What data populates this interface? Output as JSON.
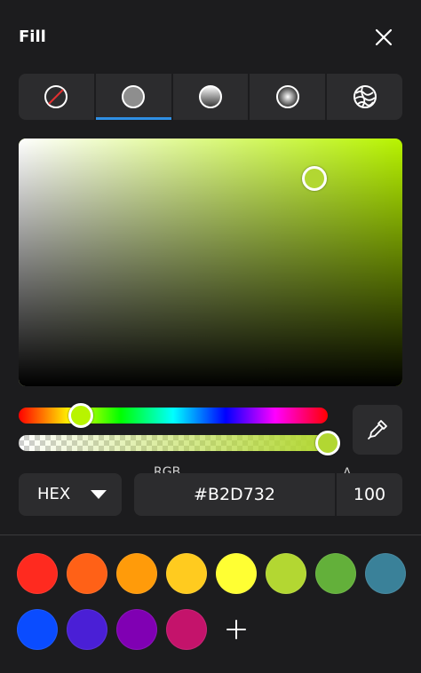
{
  "header": {
    "title": "Fill",
    "close_icon": "close-icon"
  },
  "fill_types": [
    {
      "id": "none",
      "icon": "no-fill-icon",
      "active": false
    },
    {
      "id": "solid",
      "icon": "solid-fill-icon",
      "active": true
    },
    {
      "id": "linear",
      "icon": "linear-gradient-icon",
      "active": false
    },
    {
      "id": "radial",
      "icon": "radial-gradient-icon",
      "active": false
    },
    {
      "id": "pattern",
      "icon": "pattern-fill-icon",
      "active": false
    }
  ],
  "picker": {
    "hue_color": "#b8f400",
    "saturation": 0.77,
    "brightness": 0.84,
    "hue_position": 0.2,
    "alpha_position": 1.0,
    "current_color": "#B2D732"
  },
  "value_row": {
    "mode": "HEX",
    "rgb_label": "RGB",
    "hex_value": "#B2D732",
    "alpha_label": "A",
    "alpha_value": "100"
  },
  "swatches": [
    "#ff2a1f",
    "#ff6117",
    "#ff9b0a",
    "#ffcb1f",
    "#ffff33",
    "#b3d732",
    "#63b03a",
    "#3a8199",
    "#0a4cff",
    "#4a1fd6",
    "#8000b3",
    "#c4136b"
  ],
  "add_swatch_icon": "plus-icon",
  "accent": "#2f8fe4"
}
